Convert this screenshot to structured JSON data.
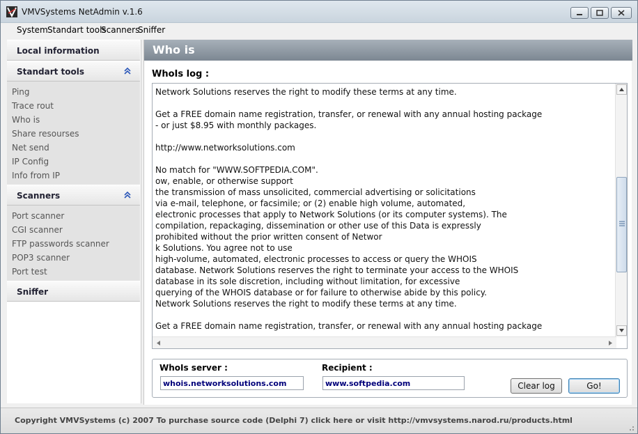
{
  "window": {
    "title": "VMVSystems NetAdmin v.1.6"
  },
  "menu": [
    "System",
    "Standart tools",
    "Scanners",
    "Sniffer"
  ],
  "sidebar": {
    "local_information": "Local information",
    "standart_tools": {
      "label": "Standart tools",
      "items": [
        "Ping",
        "Trace rout",
        "Who is",
        "Share resourses",
        "Net send",
        "IP Config",
        "Info from IP"
      ]
    },
    "scanners": {
      "label": "Scanners",
      "items": [
        "Port scanner",
        "CGI scanner",
        "FTP passwords scanner",
        "POP3 scanner",
        "Port test"
      ]
    },
    "sniffer": "Sniffer"
  },
  "main": {
    "title": "Who is",
    "log_label": "WhoIs log :",
    "log_lines": [
      "Network Solutions reserves the right to modify these terms at any time.",
      "",
      "Get a FREE domain name registration, transfer, or renewal with any annual hosting package",
      "- or just $8.95 with monthly packages.",
      "",
      "http://www.networksolutions.com",
      "",
      "No match for \"WWW.SOFTPEDIA.COM\".",
      "ow, enable, or otherwise support",
      "the transmission of mass unsolicited, commercial advertising or solicitations",
      "via e-mail, telephone, or facsimile; or (2) enable high volume, automated,",
      "electronic processes that apply to Network Solutions (or its computer systems). The",
      "compilation, repackaging, dissemination or other use of this Data is expressly",
      "prohibited without the prior written consent of Networ",
      "k Solutions. You agree not to use",
      "high-volume, automated, electronic processes to access or query the WHOIS",
      "database. Network Solutions reserves the right to terminate your access to the WHOIS",
      "database in its sole discretion, including without limitation, for excessive",
      "querying of the WHOIS database or for failure to otherwise abide by this policy.",
      "Network Solutions reserves the right to modify these terms at any time.",
      "",
      "Get a FREE domain name registration, transfer, or renewal with any annual hosting package"
    ],
    "whois_server_label": "WhoIs server :",
    "whois_server_value": "whois.networksolutions.com",
    "recipient_label": "Recipient :",
    "recipient_value": "www.softpedia.com",
    "clear_log": "Clear log",
    "go": "Go!"
  },
  "status": {
    "text": "Copyright VMVSystems (c) 2007  To purchase source code (Delphi 7) click here or visit http://vmvsystems.narod.ru/products.html"
  }
}
